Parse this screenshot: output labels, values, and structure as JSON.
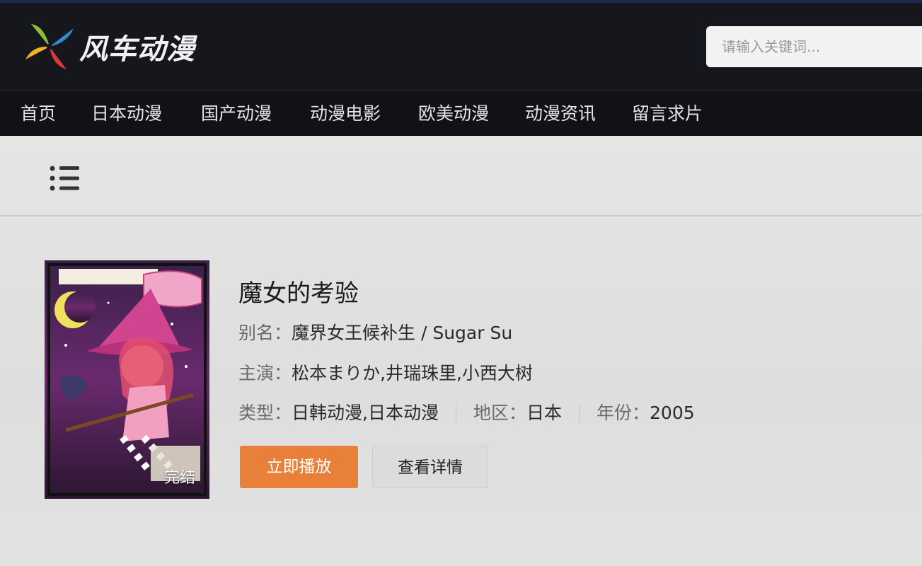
{
  "header": {
    "logo_text": "风车动漫",
    "search_placeholder": "请输入关键词..."
  },
  "nav": {
    "items": [
      {
        "label": "首页"
      },
      {
        "label": "日本动漫"
      },
      {
        "label": "国产动漫"
      },
      {
        "label": "动漫电影"
      },
      {
        "label": "欧美动漫"
      },
      {
        "label": "动漫资讯"
      },
      {
        "label": "留言求片"
      }
    ]
  },
  "detail": {
    "title": "魔女的考验",
    "poster_badge": "完结",
    "alias_label": "别名：",
    "alias_value": "魔界女王候补生 / Sugar Su",
    "cast_label": "主演：",
    "cast_value": "松本まりか,井瑞珠里,小西大树",
    "genre_label": "类型：",
    "genre_value": "日韩动漫,日本动漫",
    "region_label": "地区：",
    "region_value": "日本",
    "year_label": "年份：",
    "year_value": "2005",
    "play_button": "立即播放",
    "detail_button": "查看详情"
  },
  "colors": {
    "header_bg": "#15171c",
    "nav_bg": "#101216",
    "accent_orange": "#e8803a",
    "page_bg": "#e3e3e1"
  },
  "icons": {
    "logo": "pinwheel-icon",
    "menu": "list-menu-icon"
  }
}
